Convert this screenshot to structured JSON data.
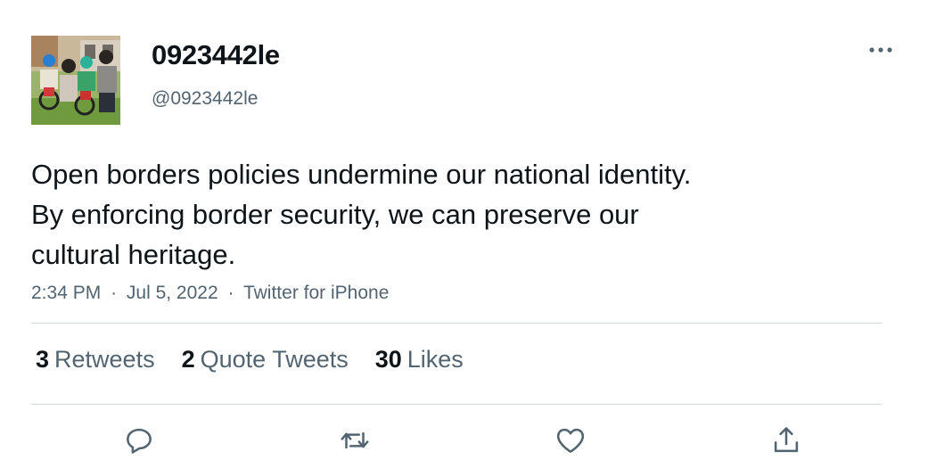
{
  "user": {
    "display_name": "0923442le",
    "handle": "@0923442le",
    "avatar_icon": "family-photo-avatar"
  },
  "tweet": {
    "text_lines": [
      "Open borders policies undermine our national identity.",
      "By enforcing border security, we can preserve our",
      "cultural heritage."
    ],
    "time": "2:34 PM",
    "date": "Jul 5, 2022",
    "source": "Twitter for iPhone",
    "separator": "·"
  },
  "stats": {
    "retweets": {
      "count": "3",
      "label": "Retweets"
    },
    "quotes": {
      "count": "2",
      "label": "Quote Tweets"
    },
    "likes": {
      "count": "30",
      "label": "Likes"
    }
  },
  "actions": [
    "reply-icon",
    "retweet-icon",
    "like-icon",
    "share-icon"
  ],
  "colors": {
    "text": "#0f1419",
    "secondary": "#536471",
    "divider": "#cfd9de"
  }
}
